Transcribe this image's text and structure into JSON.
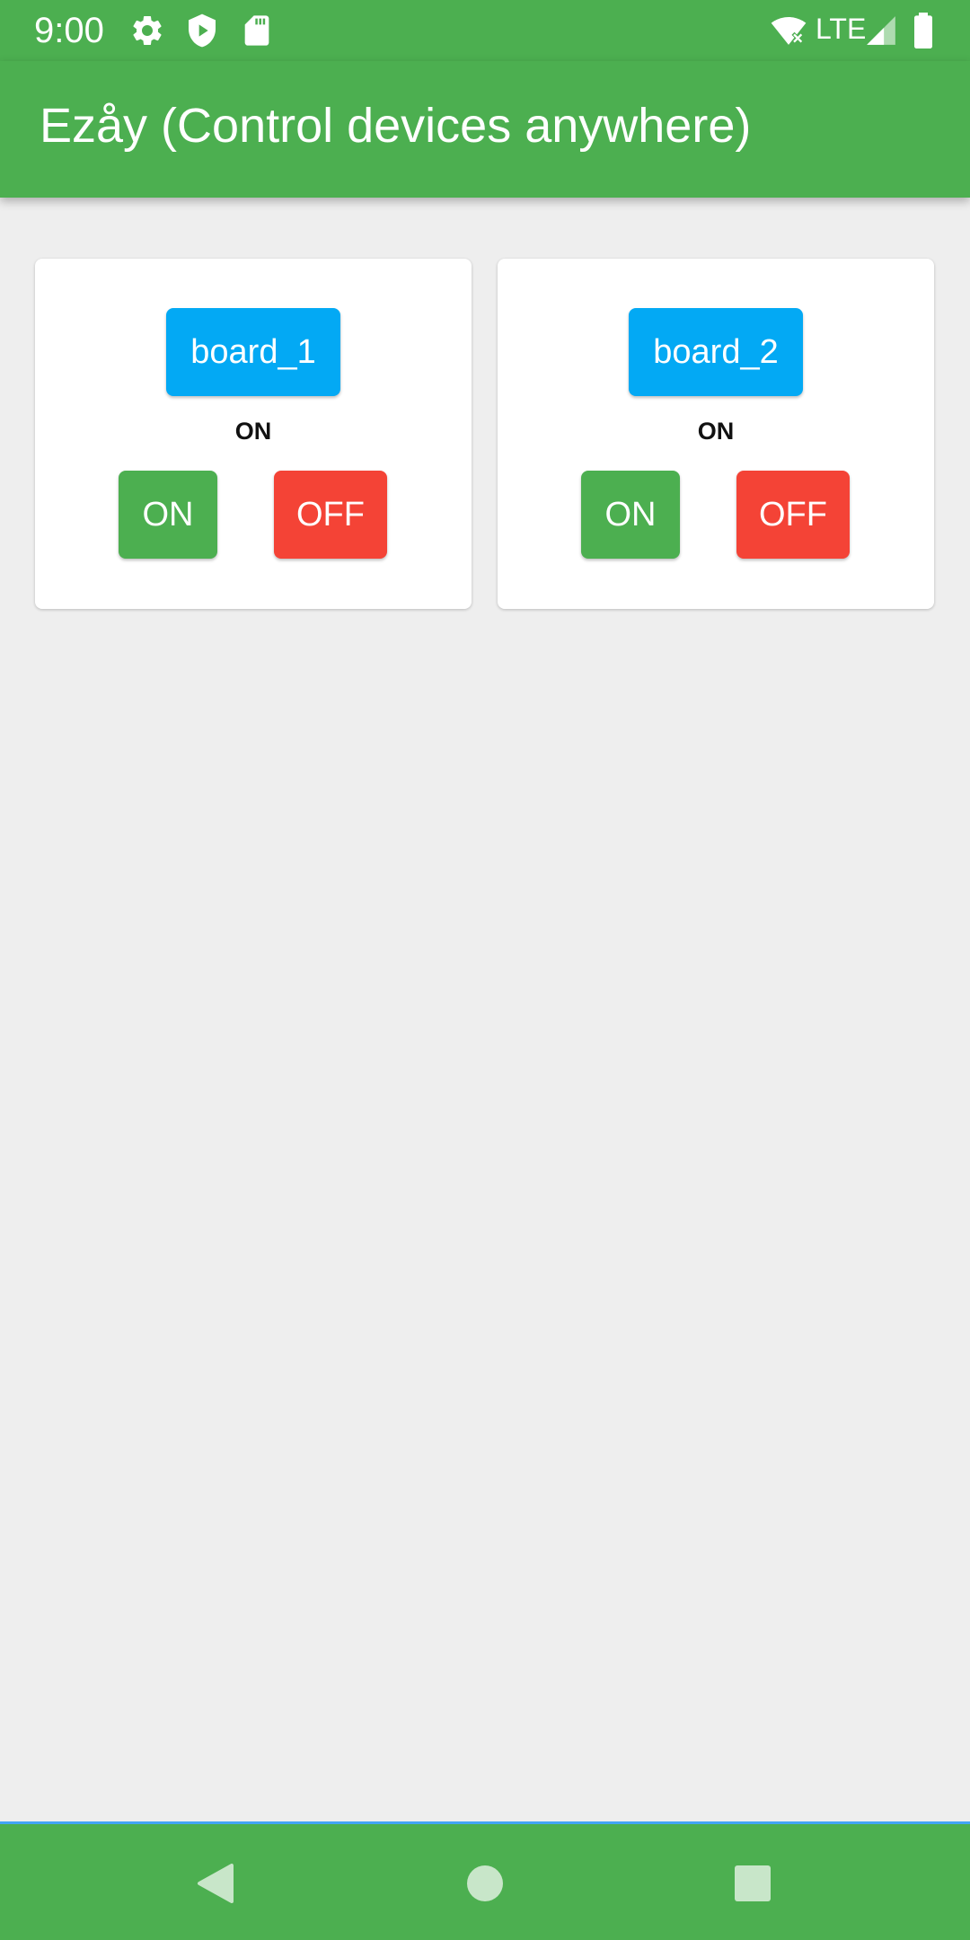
{
  "status_bar": {
    "time": "9:00",
    "network": "LTE",
    "icons": [
      "settings-icon",
      "shield-play-icon",
      "sd-card-icon",
      "wifi-off-icon",
      "signal-icon",
      "battery-icon"
    ]
  },
  "app_bar": {
    "title": "Ezåy (Control devices anywhere)"
  },
  "boards": [
    {
      "name": "board_1",
      "state": "ON",
      "on_label": "ON",
      "off_label": "OFF"
    },
    {
      "name": "board_2",
      "state": "ON",
      "on_label": "ON",
      "off_label": "OFF"
    }
  ],
  "nav_bar": {
    "buttons": [
      "back-icon",
      "home-icon",
      "recents-icon"
    ]
  },
  "colors": {
    "primary": "#4CAF50",
    "board_button": "#03A9F4",
    "off_button": "#F44336",
    "background": "#EEEEEE"
  }
}
